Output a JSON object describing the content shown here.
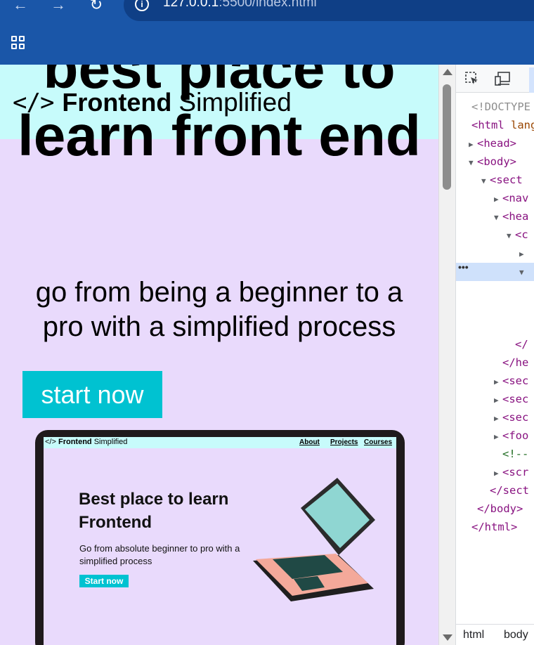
{
  "browser": {
    "url_host": "127.0.0.1",
    "url_rest": ":5500/index.html",
    "info_glyph": "i",
    "back_glyph": "←",
    "forward_glyph": "→",
    "reload_glyph": "↻"
  },
  "site": {
    "logo_mark": "</>",
    "logo_strong": "Frontend",
    "logo_light": "Simplified",
    "hero_title": "best place to learn front end",
    "hero_subtitle": "go from being a beginner to a pro with a simplified process",
    "cta_label": "start now"
  },
  "mockup": {
    "logo_mark": "</>",
    "logo_strong": "Frontend",
    "logo_light": "Simplified",
    "nav_links": [
      "About",
      "Projects",
      "Courses"
    ],
    "heading": "Best place to learn Frontend",
    "paragraph": "Go from absolute beginner to pro with a simplified process",
    "button": "Start now"
  },
  "devtools": {
    "lines": [
      {
        "tri": "",
        "tag": "<!DOCTYPE",
        "extra": "",
        "kind": "grey"
      },
      {
        "tri": "",
        "tag": "<html",
        "extra": " lang",
        "kind": "tag"
      },
      {
        "tri": "▶",
        "tag": "<head>",
        "extra": "",
        "kind": "tag"
      },
      {
        "tri": "▼",
        "tag": "<body>",
        "extra": "",
        "kind": "tag"
      },
      {
        "tri": "▼",
        "tag": "<sect",
        "extra": "",
        "kind": "tag"
      },
      {
        "tri": "▶",
        "tag": "<nav",
        "extra": "",
        "kind": "tag"
      },
      {
        "tri": "▼",
        "tag": "<hea",
        "extra": "",
        "kind": "tag"
      },
      {
        "tri": "▼",
        "tag": "<c",
        "extra": "",
        "kind": "tag"
      },
      {
        "tri": "▶",
        "tag": "",
        "extra": "",
        "kind": "tag"
      },
      {
        "tri": "▼",
        "tag": "",
        "extra": "",
        "kind": "tag"
      },
      {
        "tri": "",
        "tag": "",
        "extra": "",
        "kind": "tag"
      },
      {
        "tri": "",
        "tag": "",
        "extra": "",
        "kind": "tag"
      },
      {
        "tri": "",
        "tag": "",
        "extra": "",
        "kind": "tag"
      },
      {
        "tri": "",
        "tag": "</",
        "extra": "",
        "kind": "tag"
      },
      {
        "tri": "",
        "tag": "</he",
        "extra": "",
        "kind": "tag"
      },
      {
        "tri": "▶",
        "tag": "<sec",
        "extra": "",
        "kind": "tag"
      },
      {
        "tri": "▶",
        "tag": "<sec",
        "extra": "",
        "kind": "tag"
      },
      {
        "tri": "▶",
        "tag": "<sec",
        "extra": "",
        "kind": "tag"
      },
      {
        "tri": "▶",
        "tag": "<foo",
        "extra": "",
        "kind": "tag"
      },
      {
        "tri": "",
        "tag": "<!--",
        "extra": "",
        "kind": "cmt"
      },
      {
        "tri": "▶",
        "tag": "<scr",
        "extra": "",
        "kind": "tag"
      },
      {
        "tri": "",
        "tag": "</sect",
        "extra": "",
        "kind": "tag"
      },
      {
        "tri": "",
        "tag": "</body>",
        "extra": "",
        "kind": "tag"
      },
      {
        "tri": "",
        "tag": "</html>",
        "extra": "",
        "kind": "tag"
      }
    ],
    "selected_row_ellipsis": "•••",
    "breadcrumbs": [
      "html",
      "body"
    ]
  },
  "colors": {
    "browser_bar": "#1a56a8",
    "site_background": "#e9dafc",
    "nav_background": "#c7fbfb",
    "accent": "#00c2d1"
  }
}
